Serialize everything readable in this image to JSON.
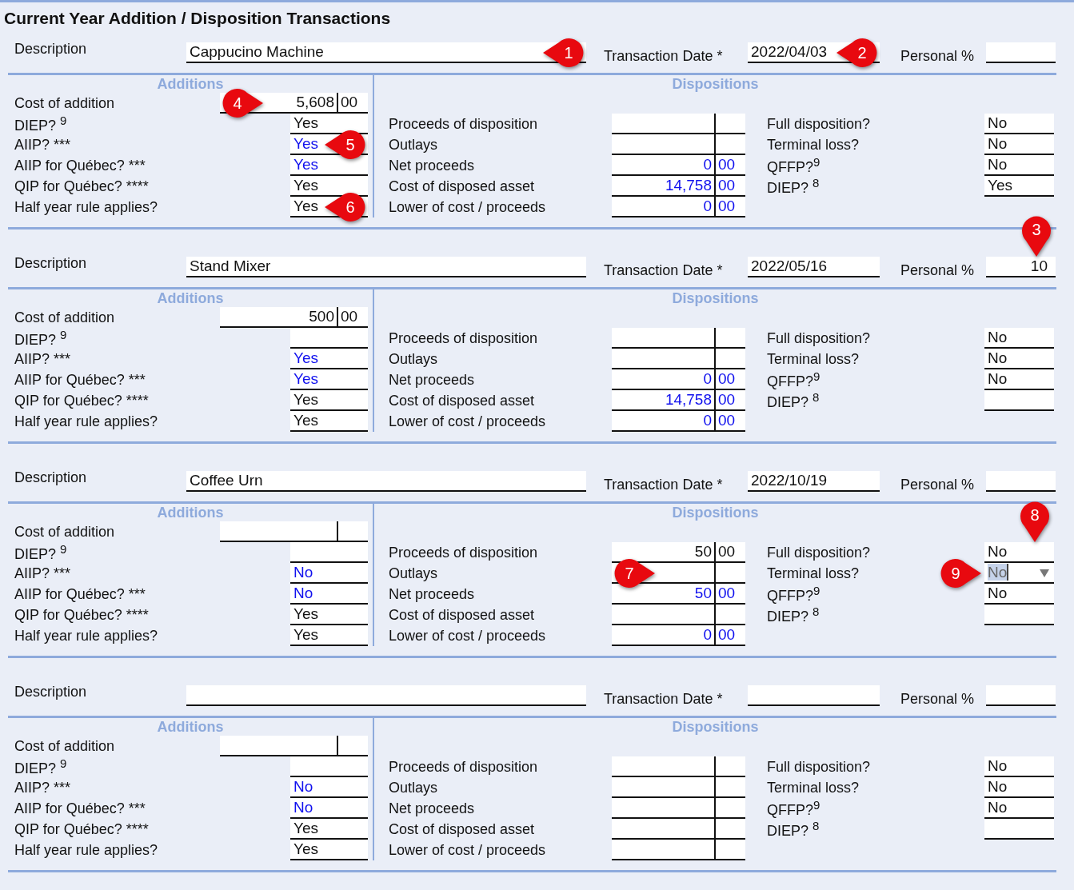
{
  "title": "Current Year Addition / Disposition Transactions",
  "transactions": [
    {
      "description": {
        "label": "Description",
        "value": "Cappucino Machine",
        "callout": {
          "label": "1",
          "kind": "inside-right"
        }
      },
      "date": {
        "label": "Transaction Date *",
        "value": "2022/04/03",
        "callout": {
          "label": "2",
          "kind": "inside-right"
        }
      },
      "personal": {
        "label": "Personal %"
      },
      "additions": {
        "heading": "Additions",
        "cost": {
          "label": "Cost of addition",
          "dollars": "5,608",
          "cents": "00",
          "computed": false,
          "callout": {
            "label": "4",
            "kind": "inside-left"
          }
        },
        "questions": [
          {
            "label": "DIEP? $^{9}$",
            "value": "Yes",
            "computed": false
          },
          {
            "label": "AIIP? ***",
            "value": "Yes",
            "computed": true,
            "callout": {
              "label": "5",
              "kind": "inside-right"
            }
          },
          {
            "label": "AIIP for Québec? ***",
            "value": "Yes",
            "computed": true
          },
          {
            "label": "QIP for Québec? ****",
            "value": "Yes",
            "computed": false
          },
          {
            "label": "Half year rule applies?",
            "value": "Yes",
            "computed": false,
            "callout": {
              "label": "6",
              "kind": "inside-right"
            }
          }
        ]
      },
      "dispositions": {
        "heading": "Dispositions",
        "amounts": [
          {
            "label": "Proceeds of disposition"
          },
          {
            "label": "Outlays"
          },
          {
            "label": "Net proceeds",
            "dollars": "0",
            "cents": "00",
            "computed": true
          },
          {
            "label": "Cost of disposed asset",
            "dollars": "14,758",
            "cents": "00",
            "computed": true
          },
          {
            "label": "Lower of cost / proceeds",
            "dollars": "0",
            "cents": "00",
            "computed": true
          }
        ],
        "questions": [
          {
            "label": "Full disposition?",
            "value": "No",
            "focused": false
          },
          {
            "label": "Terminal loss?",
            "value": "No",
            "focused": false
          },
          {
            "label": "QFFP?$^{9}$",
            "value": "No",
            "focused": false
          },
          {
            "label": "DIEP? $^{8}$",
            "value": "Yes",
            "focused": false
          }
        ]
      }
    },
    {
      "description": {
        "label": "Description",
        "value": "Stand Mixer"
      },
      "date": {
        "label": "Transaction Date *",
        "value": "2022/05/16"
      },
      "personal": {
        "label": "Personal %",
        "value": "10",
        "callout": {
          "label": "3",
          "kind": "above"
        }
      },
      "additions": {
        "heading": "Additions",
        "cost": {
          "label": "Cost of addition",
          "dollars": "500",
          "cents": "00",
          "computed": false
        },
        "questions": [
          {
            "label": "DIEP? $^{9}$"
          },
          {
            "label": "AIIP? ***",
            "value": "Yes",
            "computed": true
          },
          {
            "label": "AIIP for Québec? ***",
            "value": "Yes",
            "computed": true
          },
          {
            "label": "QIP for Québec? ****",
            "value": "Yes",
            "computed": false
          },
          {
            "label": "Half year rule applies?",
            "value": "Yes",
            "computed": false
          }
        ]
      },
      "dispositions": {
        "heading": "Dispositions",
        "amounts": [
          {
            "label": "Proceeds of disposition"
          },
          {
            "label": "Outlays"
          },
          {
            "label": "Net proceeds",
            "dollars": "0",
            "cents": "00",
            "computed": true
          },
          {
            "label": "Cost of disposed asset",
            "dollars": "14,758",
            "cents": "00",
            "computed": true
          },
          {
            "label": "Lower of cost / proceeds",
            "dollars": "0",
            "cents": "00",
            "computed": true
          }
        ],
        "questions": [
          {
            "label": "Full disposition?",
            "value": "No",
            "focused": false
          },
          {
            "label": "Terminal loss?",
            "value": "No",
            "focused": false
          },
          {
            "label": "QFFP?$^{9}$",
            "value": "No",
            "focused": false
          },
          {
            "label": "DIEP? $^{8}$",
            "focused": false
          }
        ]
      }
    },
    {
      "description": {
        "label": "Description",
        "value": "Coffee Urn"
      },
      "date": {
        "label": "Transaction Date *",
        "value": "2022/10/19"
      },
      "personal": {
        "label": "Personal %"
      },
      "additions": {
        "heading": "Additions",
        "cost": {
          "label": "Cost of addition"
        },
        "questions": [
          {
            "label": "DIEP? $^{9}$"
          },
          {
            "label": "AIIP? ***",
            "value": "No",
            "computed": true
          },
          {
            "label": "AIIP for Québec? ***",
            "value": "No",
            "computed": true
          },
          {
            "label": "QIP for Québec? ****",
            "value": "Yes",
            "computed": false
          },
          {
            "label": "Half year rule applies?",
            "value": "Yes",
            "computed": false
          }
        ]
      },
      "dispositions": {
        "heading": "Dispositions",
        "amounts": [
          {
            "label": "Proceeds of disposition",
            "dollars": "50",
            "cents": "00",
            "computed": false
          },
          {
            "label": "Outlays",
            "callout": {
              "label": "7",
              "kind": "inside-left"
            }
          },
          {
            "label": "Net proceeds",
            "dollars": "50",
            "cents": "00",
            "computed": true
          },
          {
            "label": "Cost of disposed asset"
          },
          {
            "label": "Lower of cost / proceeds",
            "dollars": "0",
            "cents": "00",
            "computed": true
          }
        ],
        "questions": [
          {
            "label": "Full disposition?",
            "value": "No",
            "focused": false,
            "callout": {
              "label": "8",
              "kind": "above"
            }
          },
          {
            "label": "Terminal loss?",
            "value": "No",
            "focused": true,
            "callout": {
              "label": "9",
              "kind": "outside-left"
            }
          },
          {
            "label": "QFFP?$^{9}$",
            "value": "No",
            "focused": false
          },
          {
            "label": "DIEP? $^{8}$",
            "focused": false
          }
        ]
      }
    },
    {
      "description": {
        "label": "Description"
      },
      "date": {
        "label": "Transaction Date *"
      },
      "personal": {
        "label": "Personal %"
      },
      "additions": {
        "heading": "Additions",
        "cost": {
          "label": "Cost of addition"
        },
        "questions": [
          {
            "label": "DIEP? $^{9}$"
          },
          {
            "label": "AIIP? ***",
            "value": "No",
            "computed": true
          },
          {
            "label": "AIIP for Québec? ***",
            "value": "No",
            "computed": true
          },
          {
            "label": "QIP for Québec? ****",
            "value": "Yes",
            "computed": false
          },
          {
            "label": "Half year rule applies?",
            "value": "Yes",
            "computed": false
          }
        ]
      },
      "dispositions": {
        "heading": "Dispositions",
        "amounts": [
          {
            "label": "Proceeds of disposition"
          },
          {
            "label": "Outlays"
          },
          {
            "label": "Net proceeds"
          },
          {
            "label": "Cost of disposed asset"
          },
          {
            "label": "Lower of cost / proceeds"
          }
        ],
        "questions": [
          {
            "label": "Full disposition?",
            "value": "No",
            "focused": false
          },
          {
            "label": "Terminal loss?",
            "value": "No",
            "focused": false
          },
          {
            "label": "QFFP?$^{9}$",
            "value": "No",
            "focused": false
          },
          {
            "label": "DIEP? $^{8}$",
            "focused": false
          }
        ]
      }
    }
  ]
}
